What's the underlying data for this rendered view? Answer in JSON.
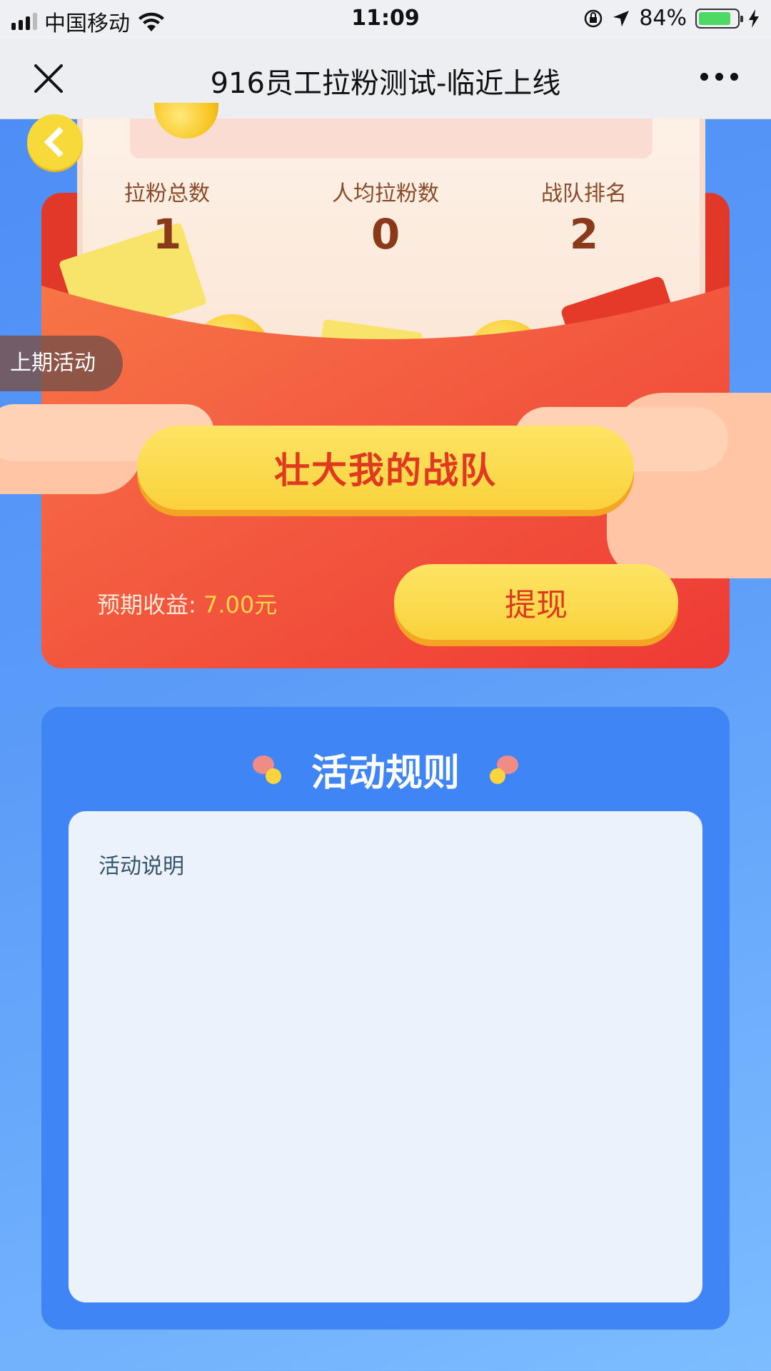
{
  "status_bar": {
    "carrier": "中国移动",
    "time": "11:09",
    "battery": "84%",
    "battery_level": 0.84,
    "battery_color": "#4cd964"
  },
  "nav": {
    "title": "916员工拉粉测试-临近上线",
    "close_icon": "close-icon",
    "more_icon": "more-icon"
  },
  "stats": [
    {
      "label": "拉粉总数",
      "value": "1"
    },
    {
      "label": "人均拉粉数",
      "value": "0"
    },
    {
      "label": "战队排名",
      "value": "2"
    }
  ],
  "prev_activity": "上期活动",
  "grow_button": "壮大我的战队",
  "earnings": {
    "label": "预期收益:",
    "amount": "7.00元"
  },
  "withdraw_button": "提现",
  "rules": {
    "title": "活动规则",
    "body": "活动说明"
  },
  "colors": {
    "accent_red": "#e0391f",
    "button_yellow": "#f9d23c",
    "panel_blue": "#3f85f5"
  }
}
